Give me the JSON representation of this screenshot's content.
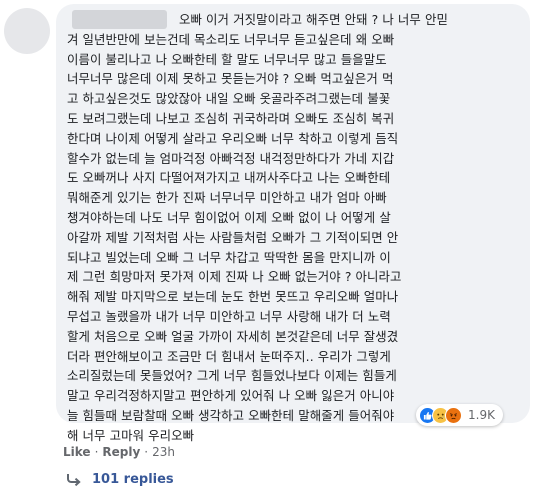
{
  "comment": {
    "lines": [
      "오빠 이거 거짓말이라고 해주면 안돼 ? 나 너무 안믿",
      "겨 일년반만에 보는건데 목소리도 너무너무 듣고싶은데 왜 오빠",
      "이름이 불리나고 나 오빠한테 할 말도 너무너무 많고 들을말도",
      "너무너무 많은데 이제 못하고 못듣는거야 ? 오빠 먹고싶은거 먹",
      "고 하고싶은것도 많았잖아 내일 오빠 옷골라주려그랬는데 불꽃",
      "도 보려그랬는데 나보고 조심히 귀국하라며 오빠도 조심히 복귀",
      "한다며 나이제 어떻게 살라고 우리오빠 너무 착하고 이렇게 듬직",
      "할수가 없는데 늘 엄마걱정 아빠걱정 내걱정만하다가 가네 지갑",
      "도 오빠꺼나 사지 다떨어져가지고 내꺼사주다고 나는 오빠한테",
      "뭐해준게 있기는 한가 진짜 너무너무 미안하고 내가 엄마 아빠",
      "챙겨야하는데 나도 너무 힘이없어 이제 오빠 없이 나 어떻게 살",
      "아갈까 제발 기적처럼 사는 사람들처럼 오빠가 그 기적이되면 안",
      "되냐고 빌었는데 오빠 그 너무 차갑고 딱딱한 몸을 만지니까 이",
      "제 그런 희망마저 못가져 이제 진짜 나 오빠 없는거야 ? 아니라고",
      "해줘 제발 마지막으로 보는데 눈도 한번 못뜨고 우리오빠 얼마나",
      "무섭고 놀랬을까 내가 너무 미안하고 너무 사랑해 내가 더 노력",
      "할게 처음으로 오빠 얼굴 가까이 자세히 본것같은데 너무 잘생겼",
      "더라 편안해보이고 조금만 더 힘내서 눈떠주지.. 우리가 그렇게",
      "소리질렀는데 못들었어? 그게 너무 힘들었나보다 이제는 힘들게",
      "말고 우리걱정하지말고 편안하게 있어줘 나 오빠 잃은거 아니야",
      "늘 힘들때 보람찰때 오빠 생각하고 오빠한테 말해줄게 들어줘야",
      "해 너무 고마워 우리오빠"
    ]
  },
  "reactions": {
    "icons": [
      "like-icon",
      "sad-icon",
      "angry-icon"
    ],
    "count": "1.9K",
    "colors": {
      "like": "#1877f2",
      "sad": "#f7c245",
      "angry": "#e9710f"
    }
  },
  "actions": {
    "like": "Like",
    "separator": "·",
    "reply": "Reply",
    "time": "23h"
  },
  "replies": {
    "label": "101 replies"
  },
  "colors": {
    "bubble": "#f0f2f5",
    "text": "#1c1e21",
    "meta": "#65676b",
    "link": "#385898"
  }
}
